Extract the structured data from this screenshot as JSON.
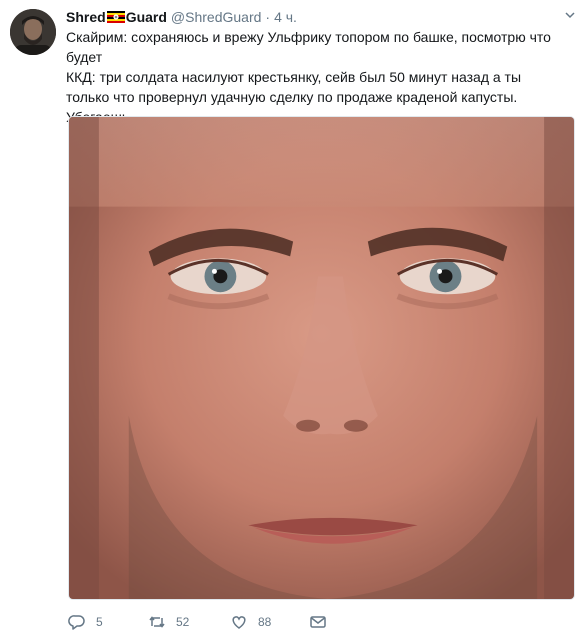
{
  "tweet": {
    "author_name_part1": "Shred",
    "author_name_part2": "Guard",
    "flag_icon": "uganda-flag-emoji",
    "handle": "@ShredGuard",
    "separator": "·",
    "time": "4 ч.",
    "text_line1": "Скайрим: сохраняюсь и врежу Ульфрику топором по башке, посмотрю что будет",
    "text_line2": "ККД: три солдата насилуют крестьянку, сейв был 50 минут назад а ты только что провернул удачную сделку по продаже краденой капусты. Убегаешь.",
    "media_description_icon": "face-closeup-photo"
  },
  "actions": {
    "reply_icon": "reply-icon",
    "reply_count": "5",
    "retweet_icon": "retweet-icon",
    "retweet_count": "52",
    "like_icon": "heart-icon",
    "like_count": "88",
    "dm_icon": "envelope-icon"
  },
  "colors": {
    "text": "#14171a",
    "muted": "#657786",
    "border": "#e1e8ed"
  }
}
